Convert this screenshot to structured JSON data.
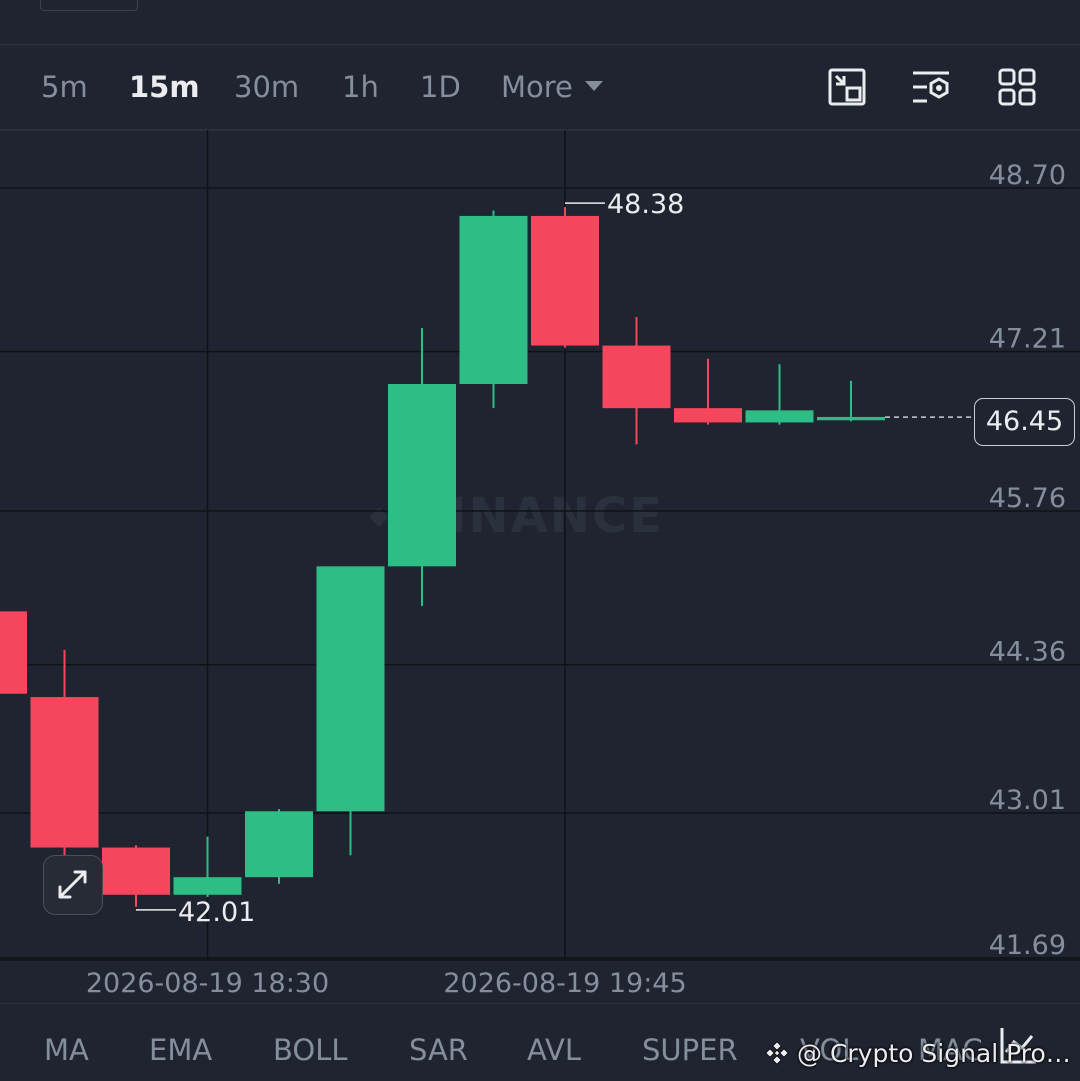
{
  "toolbar": {
    "timeframes": [
      "5m",
      "15m",
      "30m",
      "1h",
      "1D"
    ],
    "active_timeframe": "15m",
    "more_label": "More",
    "icons": [
      "chart-switch-icon",
      "indicator-settings-icon",
      "layout-grid-icon"
    ]
  },
  "watermark": {
    "brand": "BINANCE"
  },
  "footer": {
    "indicators": [
      "MA",
      "EMA",
      "BOLL",
      "SAR",
      "AVL",
      "SUPER",
      "VOL",
      "MAC"
    ],
    "channel_watermark": "@ Crypto Signal Pro 78..."
  },
  "chart_data": {
    "type": "candlestick",
    "y_ticks": [
      "48.70",
      "47.21",
      "45.76",
      "44.36",
      "43.01",
      "41.69"
    ],
    "y_tick_values": [
      48.7,
      47.21,
      45.76,
      44.36,
      43.01,
      41.69
    ],
    "ylim": [
      41.4,
      49.0
    ],
    "x_labels": [
      "2026-08-19 18:30",
      "2026-08-19 19:45"
    ],
    "x_label_candle_index": [
      3,
      8
    ],
    "last_price": "46.45",
    "last_price_value": 46.45,
    "high_label": "48.38",
    "high_value": 48.38,
    "low_label": "42.01",
    "low_value": 42.01,
    "up_color": "#2ebd85",
    "down_color": "#f6465d",
    "candles": [
      {
        "o": 44.7,
        "h": 44.8,
        "l": 43.8,
        "c": 43.95
      },
      {
        "o": 43.92,
        "h": 44.35,
        "l": 42.45,
        "c": 42.55
      },
      {
        "o": 42.55,
        "h": 42.57,
        "l": 42.01,
        "c": 42.12
      },
      {
        "o": 42.12,
        "h": 42.65,
        "l": 42.1,
        "c": 42.28
      },
      {
        "o": 42.28,
        "h": 42.9,
        "l": 42.22,
        "c": 42.88
      },
      {
        "o": 42.88,
        "h": 45.05,
        "l": 42.48,
        "c": 45.11
      },
      {
        "o": 45.11,
        "h": 47.28,
        "l": 44.75,
        "c": 46.77
      },
      {
        "o": 46.77,
        "h": 48.35,
        "l": 46.55,
        "c": 48.3
      },
      {
        "o": 48.3,
        "h": 48.38,
        "l": 47.1,
        "c": 47.12
      },
      {
        "o": 47.12,
        "h": 47.38,
        "l": 46.22,
        "c": 46.55
      },
      {
        "o": 46.55,
        "h": 47.0,
        "l": 46.4,
        "c": 46.42
      },
      {
        "o": 46.42,
        "h": 46.95,
        "l": 46.4,
        "c": 46.53
      },
      {
        "o": 46.44,
        "h": 46.8,
        "l": 46.43,
        "c": 46.47
      }
    ]
  }
}
